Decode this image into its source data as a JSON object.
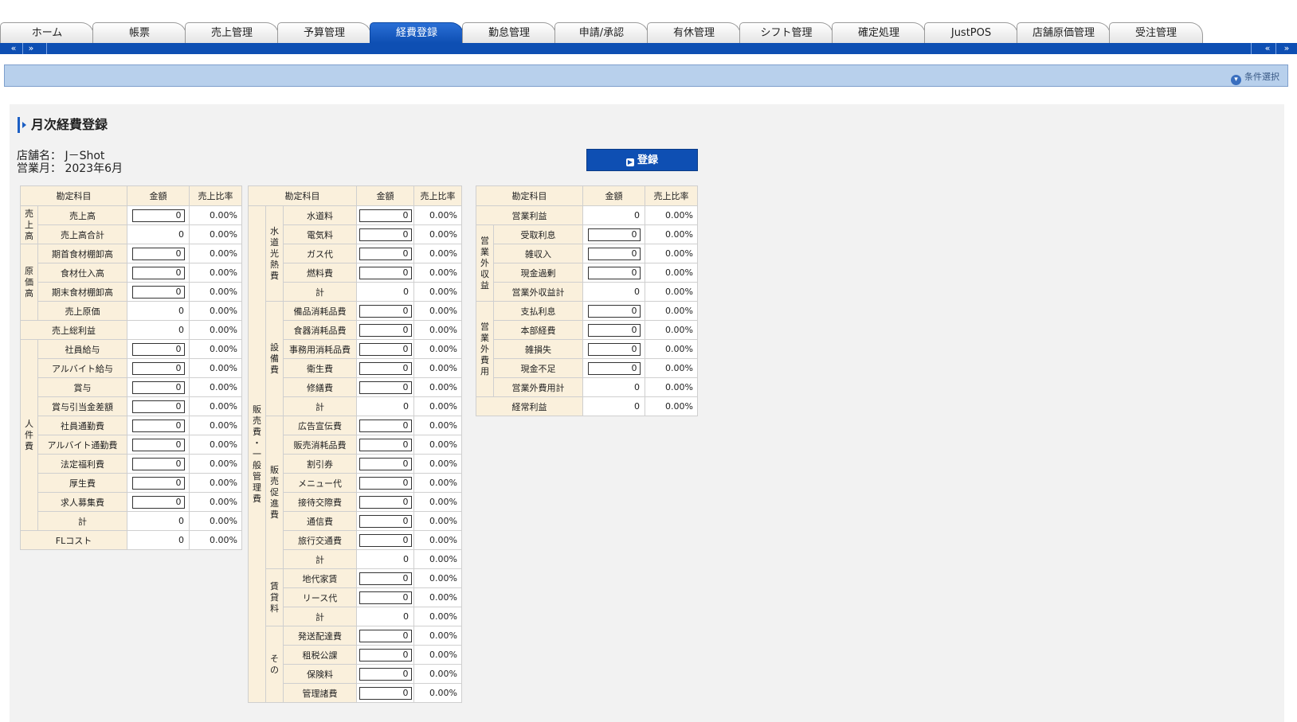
{
  "tabs": [
    "ホーム",
    "帳票",
    "売上管理",
    "予算管理",
    "経費登録",
    "勤怠管理",
    "申請/承認",
    "有休管理",
    "シフト管理",
    "確定処理",
    "JustPOS",
    "店舗原価管理",
    "受注管理"
  ],
  "active_tab": "経費登録",
  "nav": {
    "prev": "«",
    "next": "»"
  },
  "condition_button": "条件選択",
  "page_title": "月次経費登録",
  "store_label": "店舗名：",
  "store_name": "J－Shot",
  "month_label": "営業月：",
  "month_value": "2023年6月",
  "register_button": "登録",
  "headers": {
    "account": "勘定科目",
    "amount": "金額",
    "ratio": "売上比率"
  },
  "tables": [
    {
      "rows": [
        {
          "cat": "売上高",
          "items": [
            {
              "label": "売上高",
              "value": "0",
              "ratio": "0.00%",
              "input": true
            },
            {
              "label": "売上高合計",
              "value": "0",
              "ratio": "0.00%",
              "input": false
            }
          ]
        },
        {
          "cat": "原価高",
          "items": [
            {
              "label": "期首食材棚卸高",
              "value": "0",
              "ratio": "0.00%",
              "input": true
            },
            {
              "label": "食材仕入高",
              "value": "0",
              "ratio": "0.00%",
              "input": true
            },
            {
              "label": "期末食材棚卸高",
              "value": "0",
              "ratio": "0.00%",
              "input": true
            },
            {
              "label": "売上原価",
              "value": "0",
              "ratio": "0.00%",
              "input": false
            }
          ]
        },
        {
          "label": "売上総利益",
          "value": "0",
          "ratio": "0.00%",
          "input": false
        },
        {
          "cat": "人件費",
          "items": [
            {
              "label": "社員給与",
              "value": "0",
              "ratio": "0.00%",
              "input": true
            },
            {
              "label": "アルバイト給与",
              "value": "0",
              "ratio": "0.00%",
              "input": true
            },
            {
              "label": "賞与",
              "value": "0",
              "ratio": "0.00%",
              "input": true
            },
            {
              "label": "賞与引当金差額",
              "value": "0",
              "ratio": "0.00%",
              "input": true
            },
            {
              "label": "社員通勤費",
              "value": "0",
              "ratio": "0.00%",
              "input": true
            },
            {
              "label": "アルバイト通勤費",
              "value": "0",
              "ratio": "0.00%",
              "input": true
            },
            {
              "label": "法定福利費",
              "value": "0",
              "ratio": "0.00%",
              "input": true
            },
            {
              "label": "厚生費",
              "value": "0",
              "ratio": "0.00%",
              "input": true
            },
            {
              "label": "求人募集費",
              "value": "0",
              "ratio": "0.00%",
              "input": true
            },
            {
              "label": "計",
              "value": "0",
              "ratio": "0.00%",
              "input": false
            }
          ]
        },
        {
          "label": "FLコスト",
          "value": "0",
          "ratio": "0.00%",
          "input": false
        }
      ]
    },
    {
      "rows": [
        {
          "outer": "販売費・一般管理費",
          "groups": [
            {
              "cat": "水道光熱費",
              "items": [
                {
                  "label": "水道料",
                  "value": "0",
                  "ratio": "0.00%",
                  "input": true
                },
                {
                  "label": "電気料",
                  "value": "0",
                  "ratio": "0.00%",
                  "input": true
                },
                {
                  "label": "ガス代",
                  "value": "0",
                  "ratio": "0.00%",
                  "input": true
                },
                {
                  "label": "燃料費",
                  "value": "0",
                  "ratio": "0.00%",
                  "input": true
                },
                {
                  "label": "計",
                  "value": "0",
                  "ratio": "0.00%",
                  "input": false
                }
              ]
            },
            {
              "cat": "設備費",
              "items": [
                {
                  "label": "備品消耗品費",
                  "value": "0",
                  "ratio": "0.00%",
                  "input": true
                },
                {
                  "label": "食器消耗品費",
                  "value": "0",
                  "ratio": "0.00%",
                  "input": true
                },
                {
                  "label": "事務用消耗品費",
                  "value": "0",
                  "ratio": "0.00%",
                  "input": true
                },
                {
                  "label": "衛生費",
                  "value": "0",
                  "ratio": "0.00%",
                  "input": true
                },
                {
                  "label": "修繕費",
                  "value": "0",
                  "ratio": "0.00%",
                  "input": true
                },
                {
                  "label": "計",
                  "value": "0",
                  "ratio": "0.00%",
                  "input": false
                }
              ]
            },
            {
              "cat": "販売促進費",
              "items": [
                {
                  "label": "広告宣伝費",
                  "value": "0",
                  "ratio": "0.00%",
                  "input": true
                },
                {
                  "label": "販売消耗品費",
                  "value": "0",
                  "ratio": "0.00%",
                  "input": true
                },
                {
                  "label": "割引券",
                  "value": "0",
                  "ratio": "0.00%",
                  "input": true
                },
                {
                  "label": "メニュー代",
                  "value": "0",
                  "ratio": "0.00%",
                  "input": true
                },
                {
                  "label": "接待交際費",
                  "value": "0",
                  "ratio": "0.00%",
                  "input": true
                },
                {
                  "label": "通信費",
                  "value": "0",
                  "ratio": "0.00%",
                  "input": true
                },
                {
                  "label": "旅行交通費",
                  "value": "0",
                  "ratio": "0.00%",
                  "input": true
                },
                {
                  "label": "計",
                  "value": "0",
                  "ratio": "0.00%",
                  "input": false
                }
              ]
            },
            {
              "cat": "賃貸料",
              "items": [
                {
                  "label": "地代家賃",
                  "value": "0",
                  "ratio": "0.00%",
                  "input": true
                },
                {
                  "label": "リース代",
                  "value": "0",
                  "ratio": "0.00%",
                  "input": true
                },
                {
                  "label": "計",
                  "value": "0",
                  "ratio": "0.00%",
                  "input": false
                }
              ]
            },
            {
              "cat": "その",
              "items": [
                {
                  "label": "発送配達費",
                  "value": "0",
                  "ratio": "0.00%",
                  "input": true
                },
                {
                  "label": "租税公課",
                  "value": "0",
                  "ratio": "0.00%",
                  "input": true
                },
                {
                  "label": "保険料",
                  "value": "0",
                  "ratio": "0.00%",
                  "input": true
                },
                {
                  "label": "管理諸費",
                  "value": "0",
                  "ratio": "0.00%",
                  "input": true
                }
              ]
            }
          ]
        }
      ]
    },
    {
      "rows": [
        {
          "label": "営業利益",
          "value": "0",
          "ratio": "0.00%",
          "input": false
        },
        {
          "cat": "営業外収益",
          "items": [
            {
              "label": "受取利息",
              "value": "0",
              "ratio": "0.00%",
              "input": true
            },
            {
              "label": "雑収入",
              "value": "0",
              "ratio": "0.00%",
              "input": true
            },
            {
              "label": "現金過剰",
              "value": "0",
              "ratio": "0.00%",
              "input": true
            },
            {
              "label": "営業外収益計",
              "value": "0",
              "ratio": "0.00%",
              "input": false
            }
          ]
        },
        {
          "cat": "営業外費用",
          "items": [
            {
              "label": "支払利息",
              "value": "0",
              "ratio": "0.00%",
              "input": true
            },
            {
              "label": "本部経費",
              "value": "0",
              "ratio": "0.00%",
              "input": true
            },
            {
              "label": "雑損失",
              "value": "0",
              "ratio": "0.00%",
              "input": true
            },
            {
              "label": "現金不足",
              "value": "0",
              "ratio": "0.00%",
              "input": true
            },
            {
              "label": "営業外費用計",
              "value": "0",
              "ratio": "0.00%",
              "input": false
            }
          ]
        },
        {
          "label": "経常利益",
          "value": "0",
          "ratio": "0.00%",
          "input": false
        }
      ]
    }
  ]
}
